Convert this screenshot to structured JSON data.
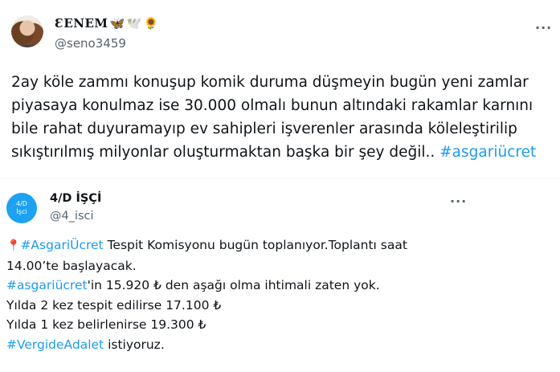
{
  "tweet": {
    "author_name": "ƐENEM",
    "name_emojis": [
      "🦋",
      "🕊️",
      "🌻"
    ],
    "handle": "@seno3459",
    "text_lines": [
      "2ay  köle zammı konuşup komik duruma düşmeyin bugün yeni zamlar",
      "piyasaya konulmaz ise 30.000 olmalı bunun altındaki rakamlar karnını",
      "bile rahat duyuramayıp ev sahipleri işverenler arasında köleleştirilip",
      "sıkıştırılmış milyonlar oluşturmaktan başka bir şey değil.. "
    ],
    "hashtag": "#asgariücret",
    "more_label": "···"
  },
  "quoted": {
    "author_name": "4/D İŞÇİ",
    "handle": "@4_isci",
    "avatar_line1": "4/D",
    "avatar_line2": "İşci",
    "more_label": "···",
    "line1_pin": "📍",
    "line1_hashtag": "#AsgariÜcret",
    "line1_rest": " Tespit Komisyonu bugün toplanıyor.Toplantı saat",
    "line2": "14.00’te başlayacak.",
    "line3_hashtag": "#asgariücret",
    "line3_rest": "'in 15.920 ₺ den aşağı olma ihtimali  zaten yok.",
    "line4": "Yılda 2 kez tespit edilirse 17.100 ₺",
    "line5": "Yılda 1 kez belirlenirse 19.300 ₺",
    "line6_hashtag": "#VergideAdalet",
    "line6_rest": " istiyoruz."
  },
  "colors": {
    "link": "#1d9bf0",
    "secondary": "#536471",
    "text": "#0f1419"
  }
}
